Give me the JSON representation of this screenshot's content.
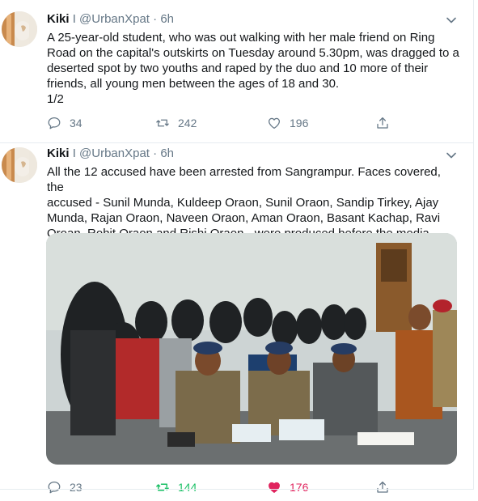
{
  "tweets": [
    {
      "display_name": "Kiki",
      "separator": "I",
      "handle": "@UrbanXpat",
      "dot": "·",
      "time": "6h",
      "text": "A 25-year-old student, who was out walking with her male friend on Ring\nRoad on the capital's outskirts on Tuesday around 5.30pm, was dragged to a\ndeserted spot by two youths and raped by the duo and 10 more of their\nfriends, all young men between the ages of 18 and 30.\n1/2",
      "replies": "34",
      "retweets": "242",
      "likes": "196"
    },
    {
      "display_name": "Kiki",
      "separator": "I",
      "handle": "@UrbanXpat",
      "dot": "·",
      "time": "6h",
      "text": "All the 12 accused have been arrested from Sangrampur. Faces covered, the\naccused - Sunil Munda, Kuldeep Oraon, Sunil Oraon, Sandip Tirkey, Ajay\nMunda, Rajan Oraon, Naveen Oraon, Aman Oraon, Basant Kachap, Ravi\nOroan, Rohit Oraon and Rishi Oraon - were produced before the media.",
      "replies": "23",
      "retweets": "144",
      "likes": "176"
    }
  ],
  "colors": {
    "text": "#14171a",
    "secondary": "#657786",
    "retweet_active": "#17bf63",
    "like_active": "#e0245e",
    "border": "#e6ecf0"
  },
  "icons": [
    "chevron-down-icon",
    "reply-icon",
    "retweet-icon",
    "like-icon",
    "share-icon"
  ]
}
